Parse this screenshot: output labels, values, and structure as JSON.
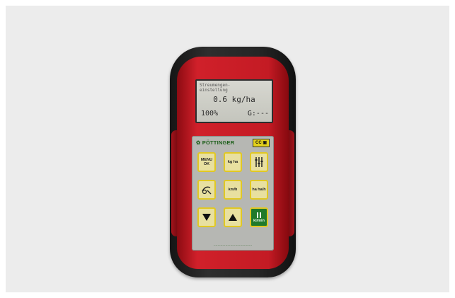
{
  "device": {
    "lcd": {
      "line1": "Streumengen-",
      "line2": "einstellung",
      "value": "0.6 kg/ha",
      "percent": "100%",
      "g_readout": "G:---"
    },
    "brand": "✿ PÖTTINGER",
    "badge": "CC ▣",
    "keys": {
      "menu": "MENU OK",
      "kgha": "kg ha",
      "km": "km/h",
      "hah": "ha ha/h",
      "green": "kl/min"
    },
    "footer": "......................................."
  }
}
